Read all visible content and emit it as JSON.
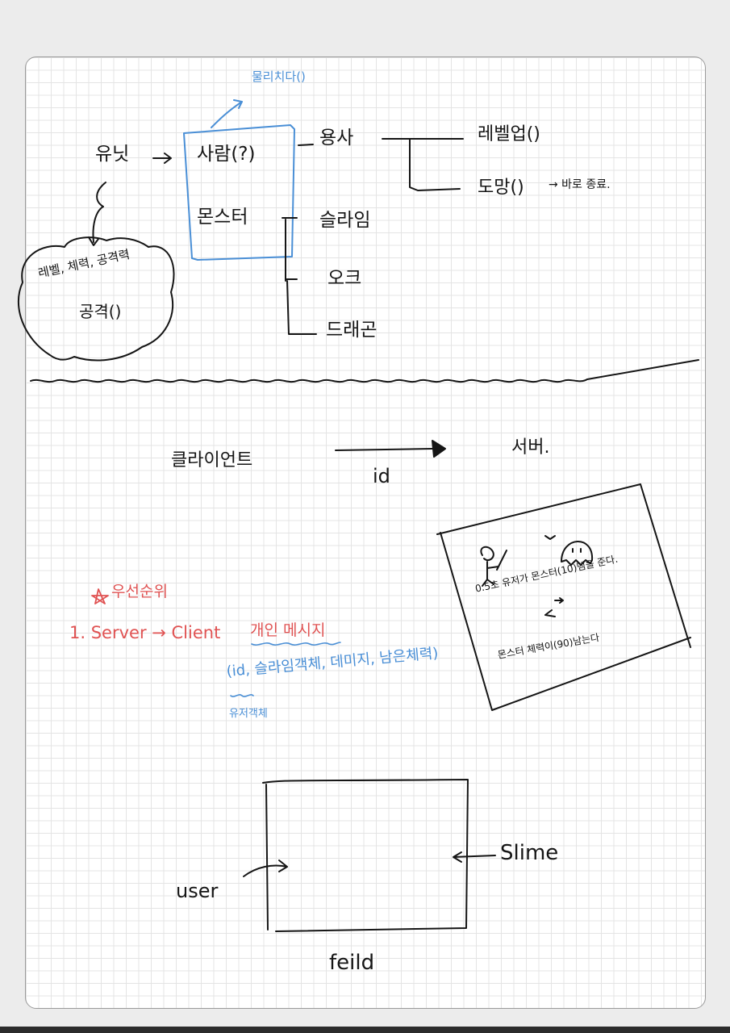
{
  "colors": {
    "ink": "#151515",
    "blue": "#4a8fd6",
    "red": "#e05353"
  },
  "diagram": {
    "knockback": "물리치다()",
    "unit": "유닛",
    "human": "사람(?)",
    "monster": "몬스터",
    "hero": "용사",
    "levelup": "레벨업()",
    "flee": "도망()",
    "flee_note": "→ 바로 종료.",
    "slime": "슬라임",
    "orc": "오크",
    "dragon": "드래곤",
    "cloud_stats": "레벨, 체력, 공격력",
    "cloud_attack": "공격()"
  },
  "network": {
    "client": "클라이언트",
    "server": "서버.",
    "id_label": "id"
  },
  "sketch": {
    "line1": "0.5초 유저가 몬스터(10)뎀을 준다.",
    "line2": "몬스터 체력이(90)남는다"
  },
  "priority": {
    "title": "우선순위",
    "item1_prefix": "1. Server → Client",
    "item1_emph": "개인 메시지",
    "params": "(id, 슬라임객체, 데미지, 남은체력)",
    "user_obj": "유저객체"
  },
  "field": {
    "user": "user",
    "slime": "Slime",
    "label": "feild"
  }
}
